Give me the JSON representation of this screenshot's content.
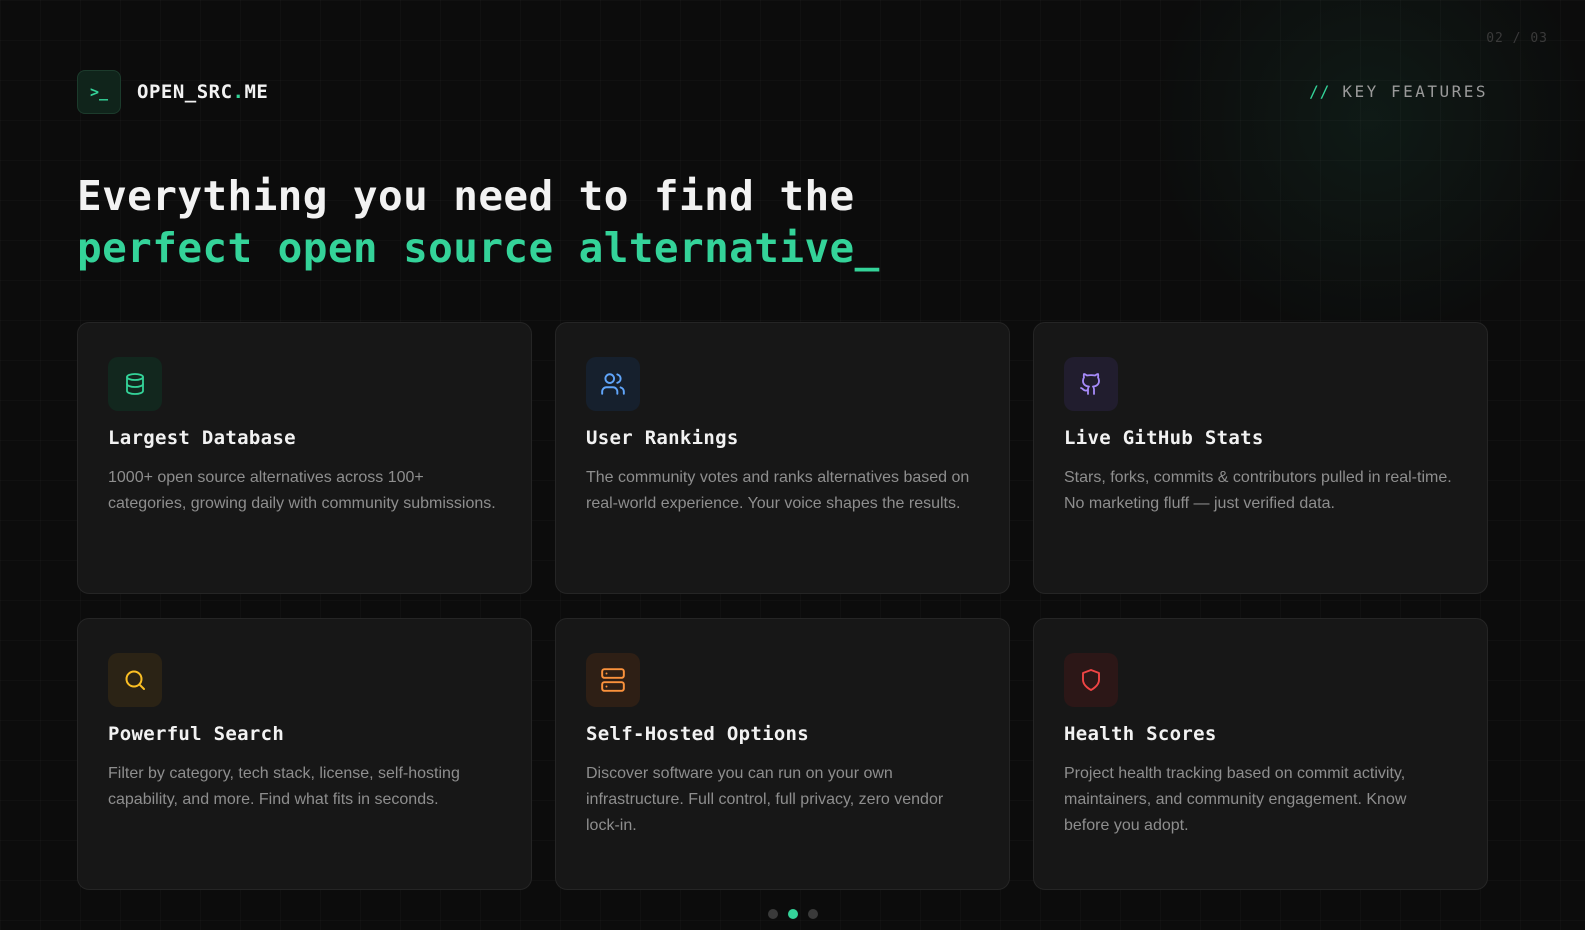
{
  "page_counter": "02 / 03",
  "brand": {
    "logo_text": ">_",
    "name_prefix": "OPEN_SRC",
    "name_dot": ".",
    "name_suffix": "ME"
  },
  "section_label": {
    "slashes": "//",
    "text": "KEY FEATURES"
  },
  "headline": {
    "line1": "Everything you need to find the",
    "line2": "perfect open source alternative_"
  },
  "features": [
    {
      "icon": "database-icon",
      "accent": "#34d399",
      "icon_bg": "#12271e",
      "title": "Largest Database",
      "description": "1000+ open source alternatives across 100+ categories, growing daily with community submissions."
    },
    {
      "icon": "users-icon",
      "accent": "#60a5fa",
      "icon_bg": "#16202d",
      "title": "User Rankings",
      "description": "The community votes and ranks alternatives based on real-world experience. Your voice shapes the results."
    },
    {
      "icon": "github-icon",
      "accent": "#a78bfa",
      "icon_bg": "#211d2e",
      "title": "Live GitHub Stats",
      "description": "Stars, forks, commits & contributors pulled in real-time. No marketing fluff — just verified data."
    },
    {
      "icon": "search-icon",
      "accent": "#fbbf24",
      "icon_bg": "#2b2315",
      "title": "Powerful Search",
      "description": "Filter by category, tech stack, license, self-hosting capability, and more. Find what fits in seconds."
    },
    {
      "icon": "server-icon",
      "accent": "#fb923c",
      "icon_bg": "#2e1f15",
      "title": "Self-Hosted Options",
      "description": "Discover software you can run on your own infrastructure. Full control, full privacy, zero vendor lock-in."
    },
    {
      "icon": "shield-icon",
      "accent": "#ef4444",
      "icon_bg": "#2c1717",
      "title": "Health Scores",
      "description": "Project health tracking based on commit activity, maintainers, and community engagement. Know before you adopt."
    }
  ],
  "pagination": {
    "total": 3,
    "active": 1
  }
}
